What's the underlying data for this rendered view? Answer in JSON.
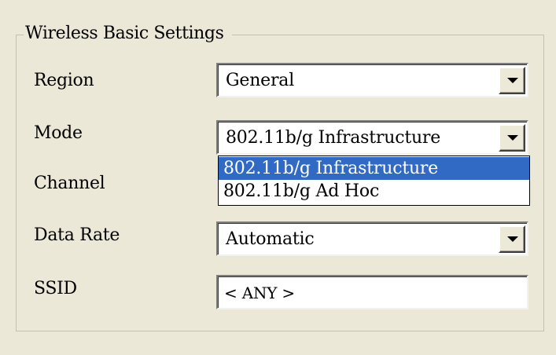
{
  "group": {
    "title": "Wireless Basic Settings"
  },
  "region": {
    "label": "Region",
    "value": "General"
  },
  "mode": {
    "label": "Mode",
    "value": "802.11b/g Infrastructure",
    "options": [
      "802.11b/g Infrastructure",
      "802.11b/g Ad Hoc"
    ],
    "selected_option": "802.11b/g Infrastructure"
  },
  "channel": {
    "label": "Channel"
  },
  "data_rate": {
    "label": "Data Rate",
    "value": "Automatic"
  },
  "ssid": {
    "label": "SSID",
    "value": "< ANY >"
  },
  "icons": {
    "dropdown": "chevron-down-icon"
  },
  "colors": {
    "background": "#ebe8d8",
    "selection": "#316ac5"
  }
}
